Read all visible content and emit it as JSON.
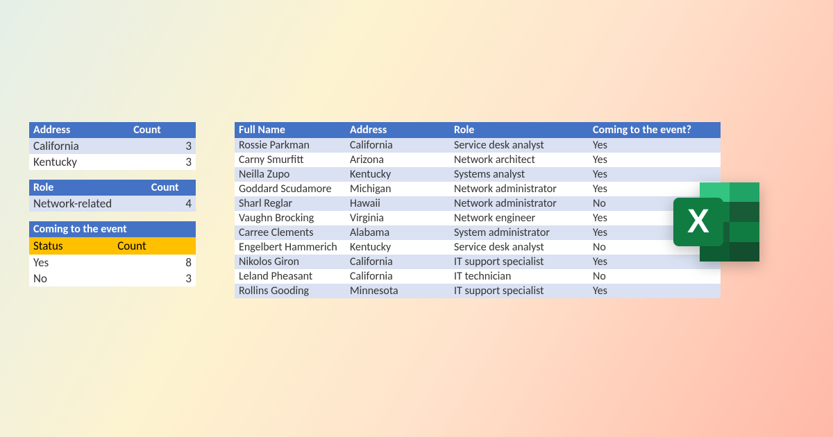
{
  "summary": {
    "address": {
      "header_label": "Address",
      "count_label": "Count",
      "rows": [
        {
          "label": "California",
          "count": 3
        },
        {
          "label": "Kentucky",
          "count": 3
        }
      ]
    },
    "role": {
      "header_label": "Role",
      "count_label": "Count",
      "rows": [
        {
          "label": "Network-related",
          "count": 4
        }
      ]
    },
    "event": {
      "title": "Coming to the event",
      "status_label": "Status",
      "count_label": "Count",
      "rows": [
        {
          "label": "Yes",
          "count": 8
        },
        {
          "label": "No",
          "count": 3
        }
      ]
    }
  },
  "main_table": {
    "headers": {
      "full_name": "Full Name",
      "address": "Address",
      "role": "Role",
      "coming": "Coming to the event?"
    },
    "rows": [
      {
        "full_name": "Rossie Parkman",
        "address": "California",
        "role": "Service desk analyst",
        "coming": "Yes"
      },
      {
        "full_name": "Carny Smurfitt",
        "address": "Arizona",
        "role": "Network architect",
        "coming": "Yes"
      },
      {
        "full_name": "Neilla Zupo",
        "address": "Kentucky",
        "role": "Systems analyst",
        "coming": "Yes"
      },
      {
        "full_name": "Goddard Scudamore",
        "address": "Michigan",
        "role": "Network administrator",
        "coming": "Yes"
      },
      {
        "full_name": "Sharl Reglar",
        "address": "Hawaii",
        "role": "Network administrator",
        "coming": "No"
      },
      {
        "full_name": "Vaughn Brocking",
        "address": "Virginia",
        "role": "Network engineer",
        "coming": "Yes"
      },
      {
        "full_name": "Carree Clements",
        "address": "Alabama",
        "role": "System administrator",
        "coming": "Yes"
      },
      {
        "full_name": "Engelbert Hammerich",
        "address": "Kentucky",
        "role": "Service desk analyst",
        "coming": "No"
      },
      {
        "full_name": "Nikolos Giron",
        "address": "California",
        "role": "IT support specialist",
        "coming": "Yes"
      },
      {
        "full_name": "Leland Pheasant",
        "address": "California",
        "role": "IT technician",
        "coming": "No"
      },
      {
        "full_name": "Rollins Gooding",
        "address": "Minnesota",
        "role": "IT support specialist",
        "coming": "Yes"
      }
    ]
  }
}
